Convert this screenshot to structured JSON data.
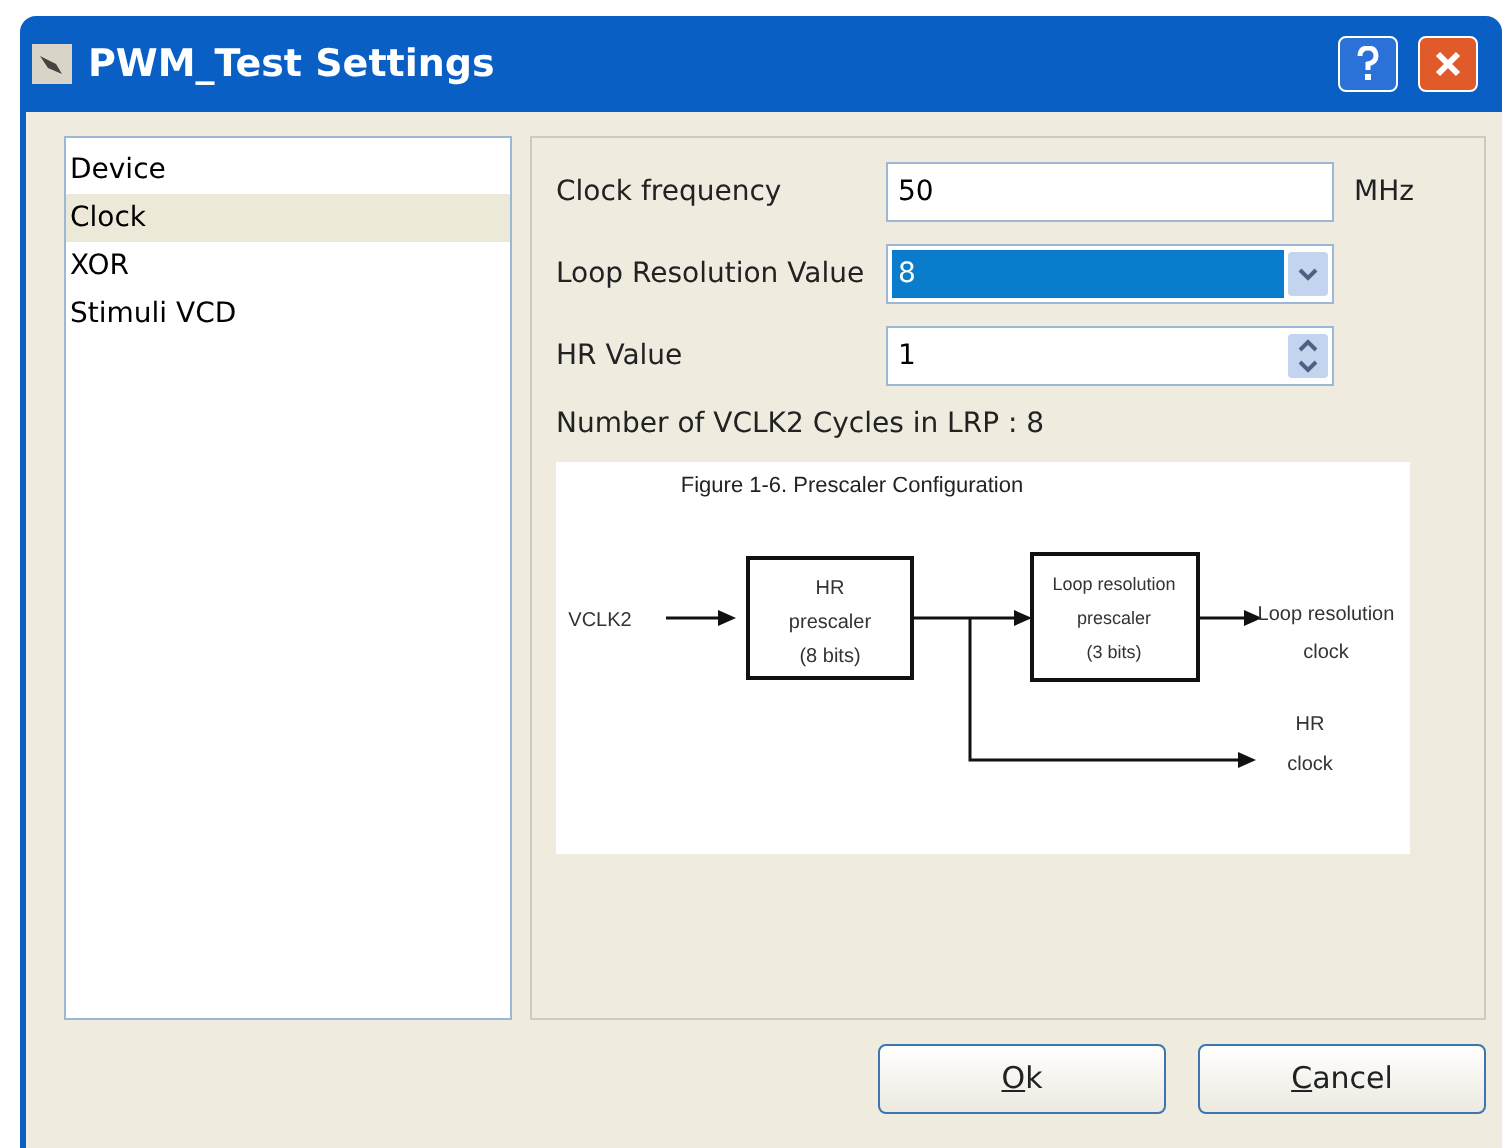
{
  "window": {
    "title": "PWM_Test Settings"
  },
  "sidebar": {
    "items": [
      {
        "label": "Device",
        "selected": false
      },
      {
        "label": "Clock",
        "selected": true
      },
      {
        "label": "XOR",
        "selected": false
      },
      {
        "label": "Stimuli VCD",
        "selected": false
      }
    ]
  },
  "form": {
    "fields": [
      {
        "kind": "text",
        "label": "Clock frequency",
        "value": "50",
        "unit": "MHz"
      },
      {
        "kind": "dropdown",
        "label": "Loop Resolution Value",
        "value": "8",
        "focused": true
      },
      {
        "kind": "spinner",
        "label": "HR Value",
        "value": "1"
      }
    ],
    "info": "Number of VCLK2 Cycles in LRP : 8"
  },
  "figure": {
    "title": "Figure 1-6. Prescaler Configuration",
    "input": "VCLK2",
    "block_1": [
      "HR",
      "prescaler",
      "(8 bits)"
    ],
    "block_2": [
      "Loop resolution",
      "prescaler",
      "(3 bits)"
    ],
    "output_1": [
      "Loop resolution",
      "clock"
    ],
    "output_2": [
      "HR",
      "clock"
    ]
  },
  "buttons": [
    "Ok",
    "Cancel"
  ]
}
